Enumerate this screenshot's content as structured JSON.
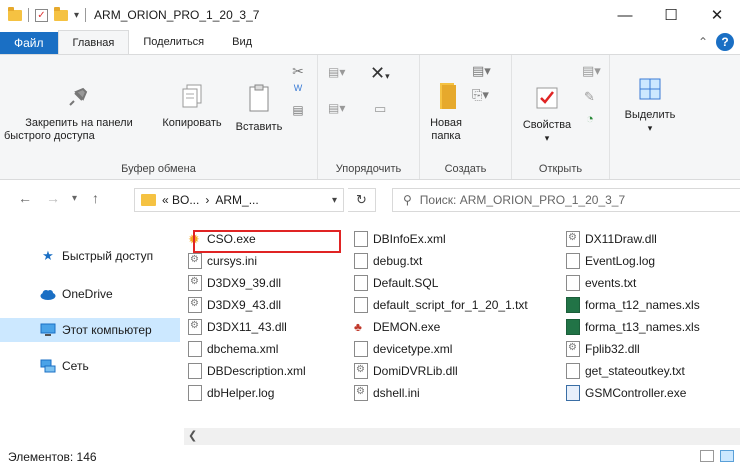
{
  "window": {
    "title": "ARM_ORION_PRO_1_20_3_7",
    "minimize_glyph": "—",
    "maximize_glyph": "☐",
    "close_glyph": "✕"
  },
  "ribbon_tabs": {
    "file": "Файл",
    "home": "Главная",
    "share": "Поделиться",
    "view": "Вид"
  },
  "ribbon": {
    "clipboard": {
      "pin_label_line1": "Закрепить на панели",
      "pin_label_line2": "быстрого доступа",
      "copy": "Копировать",
      "paste": "Вставить",
      "group": "Буфер обмена"
    },
    "organize": {
      "group": "Упорядочить"
    },
    "new": {
      "new_folder_line1": "Новая",
      "new_folder_line2": "папка",
      "group": "Создать"
    },
    "open": {
      "properties": "Свойства",
      "group": "Открыть"
    },
    "select": {
      "select_label": "Выделить"
    }
  },
  "address": {
    "path_part1": "«  BO...",
    "separator": "›",
    "path_part2": "ARM_...",
    "search_placeholder": "Поиск: ARM_ORION_PRO_1_20_3_7"
  },
  "nav_pane": {
    "items": [
      {
        "label": "Быстрый доступ",
        "icon": "star-icon"
      },
      {
        "label": "OneDrive",
        "icon": "cloud-icon"
      },
      {
        "label": "Этот компьютер",
        "icon": "computer-icon",
        "selected": true
      },
      {
        "label": "Сеть",
        "icon": "network-icon"
      }
    ]
  },
  "files": {
    "columns": [
      [
        {
          "name": "CSO.exe",
          "type": "exe-sun",
          "highlighted": true
        },
        {
          "name": "cursys.ini",
          "type": "ini"
        },
        {
          "name": "D3DX9_39.dll",
          "type": "dll"
        },
        {
          "name": "D3DX9_43.dll",
          "type": "dll"
        },
        {
          "name": "D3DX11_43.dll",
          "type": "dll"
        },
        {
          "name": "dbchema.xml",
          "type": "doc"
        },
        {
          "name": "DBDescription.xml",
          "type": "doc"
        },
        {
          "name": "dbHelper.log",
          "type": "doc"
        }
      ],
      [
        {
          "name": "DBInfoEx.xml",
          "type": "doc"
        },
        {
          "name": "debug.txt",
          "type": "doc"
        },
        {
          "name": "Default.SQL",
          "type": "doc"
        },
        {
          "name": "default_script_for_1_20_1.txt",
          "type": "doc"
        },
        {
          "name": "DEMON.exe",
          "type": "exe-demon"
        },
        {
          "name": "devicetype.xml",
          "type": "doc"
        },
        {
          "name": "DomiDVRLib.dll",
          "type": "dll"
        },
        {
          "name": "dshell.ini",
          "type": "ini"
        }
      ],
      [
        {
          "name": "DX11Draw.dll",
          "type": "dll"
        },
        {
          "name": "EventLog.log",
          "type": "doc"
        },
        {
          "name": "events.txt",
          "type": "doc"
        },
        {
          "name": "forma_t12_names.xls",
          "type": "xls"
        },
        {
          "name": "forma_t13_names.xls",
          "type": "xls"
        },
        {
          "name": "Fplib32.dll",
          "type": "dll"
        },
        {
          "name": "get_stateoutkey.txt",
          "type": "doc"
        },
        {
          "name": "GSMController.exe",
          "type": "exe"
        }
      ]
    ]
  },
  "status": {
    "count": "Элементов: 146"
  },
  "colors": {
    "accent": "#1a6fc4",
    "selection": "#cce8ff",
    "highlight_border": "#e02424"
  }
}
